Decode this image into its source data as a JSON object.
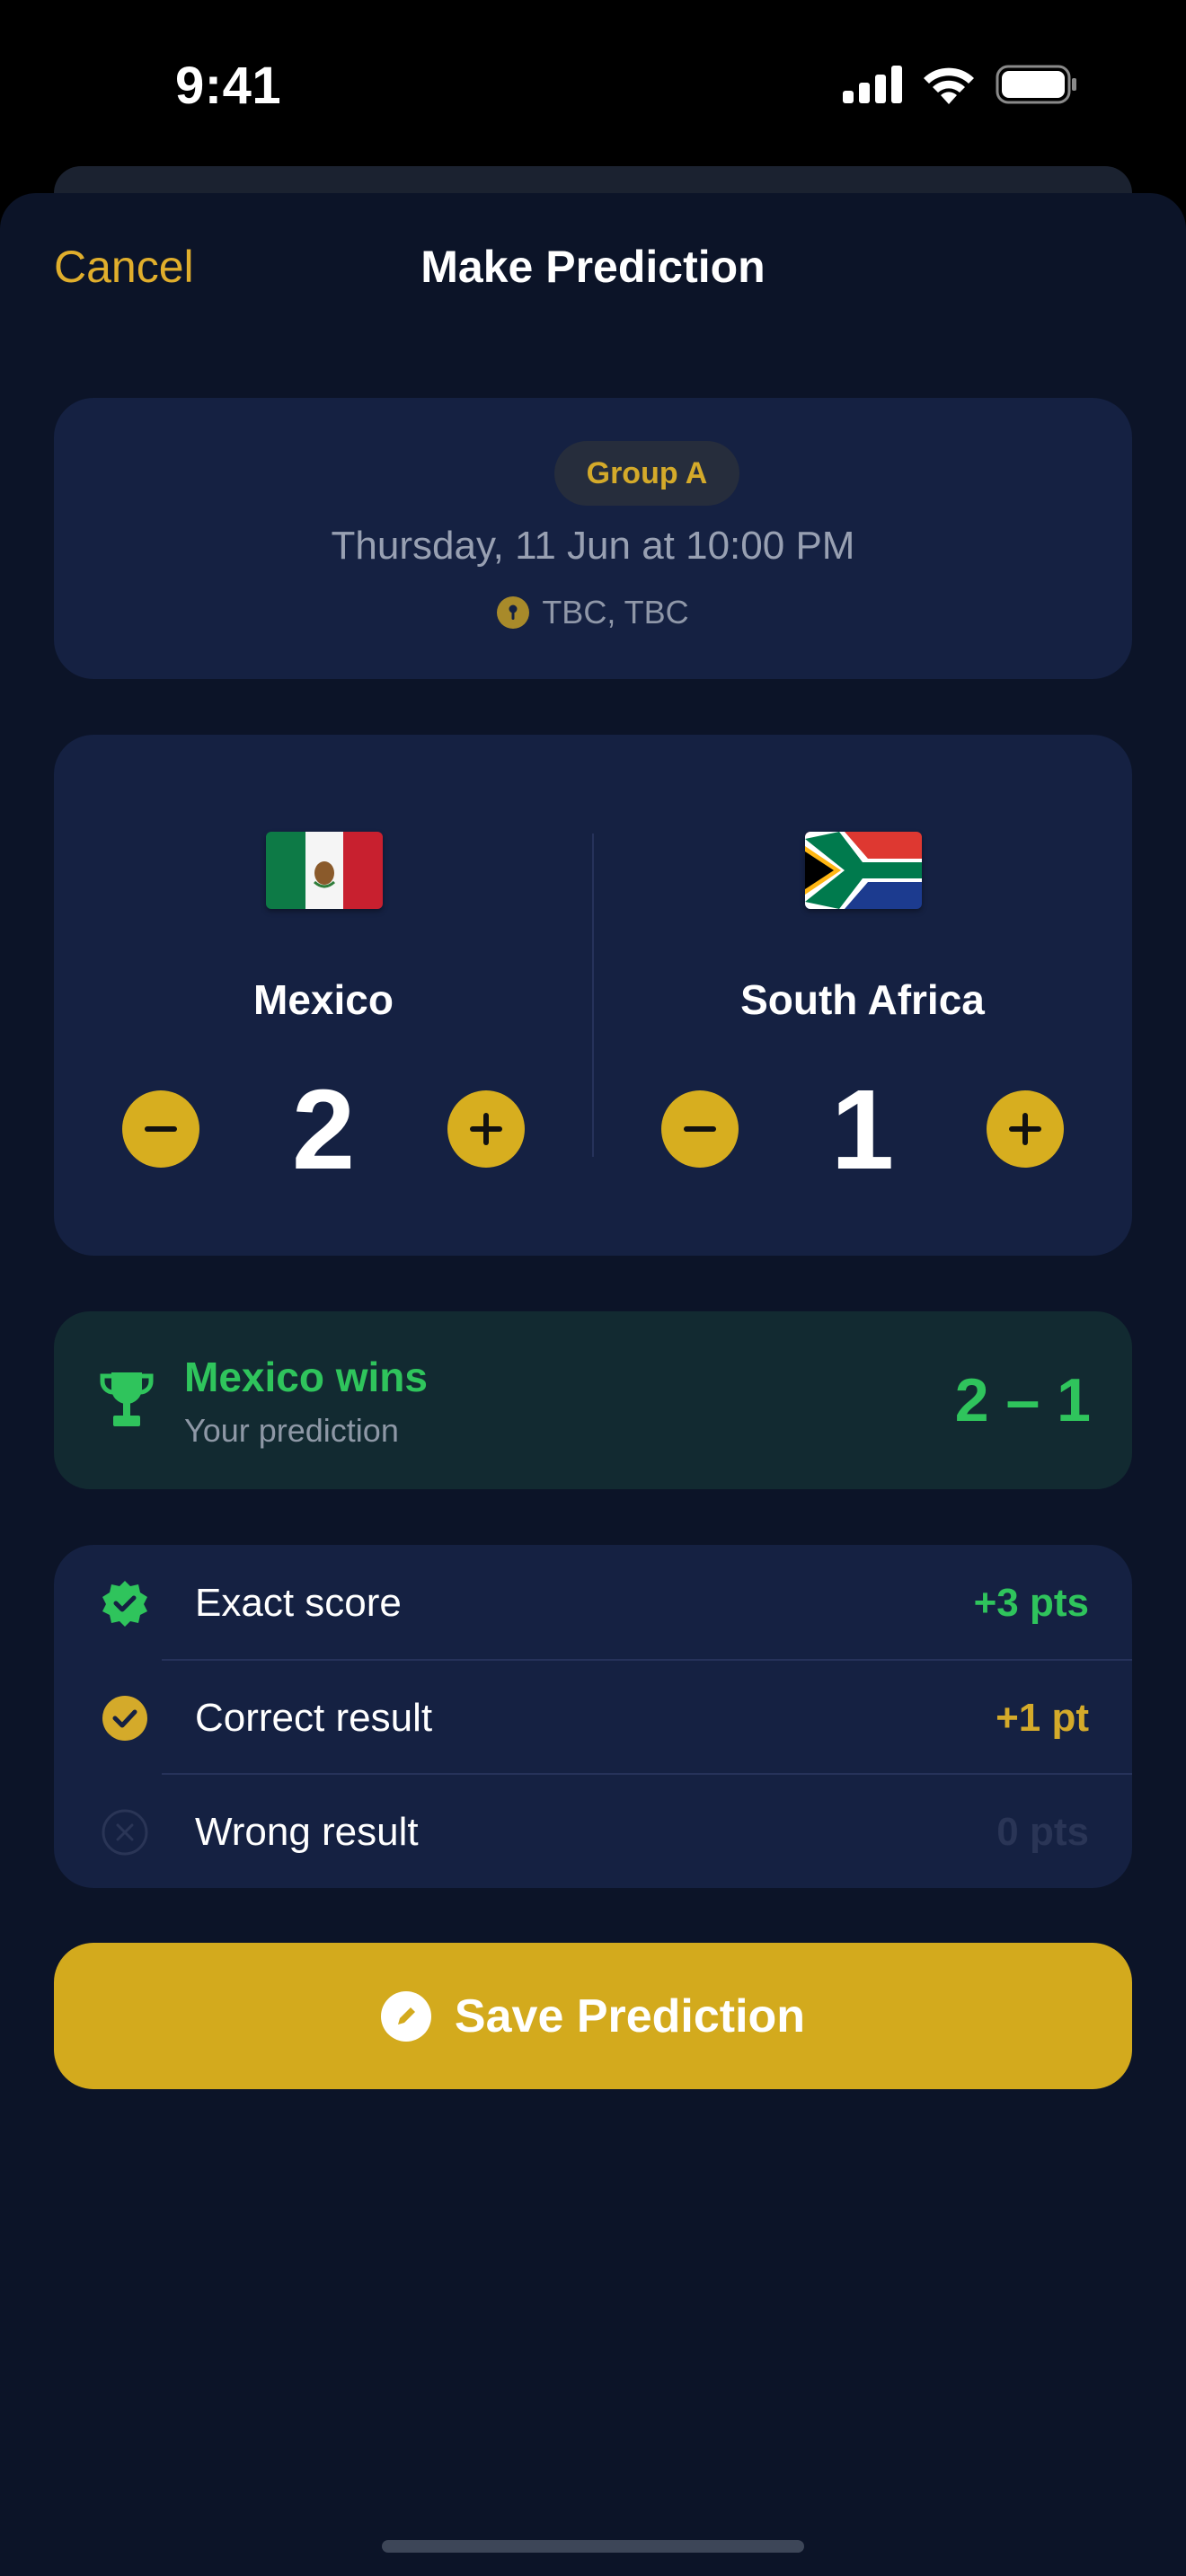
{
  "status_bar": {
    "time": "9:41"
  },
  "nav": {
    "cancel_label": "Cancel",
    "title": "Make Prediction"
  },
  "match": {
    "group": "Group A",
    "date": "Thursday, 11 Jun at 10:00 PM",
    "venue": "TBC, TBC"
  },
  "home_team": {
    "name": "Mexico",
    "flag": "mexico-flag",
    "score": "2"
  },
  "away_team": {
    "name": "South Africa",
    "flag": "south-africa-flag",
    "score": "1"
  },
  "prediction": {
    "title": "Mexico wins",
    "subtitle": "Your prediction",
    "score": "2 – 1"
  },
  "points": [
    {
      "label": "Exact score",
      "value": "+3 pts",
      "icon": "check-badge-icon",
      "color": "#2fc45c"
    },
    {
      "label": "Correct result",
      "value": "+1 pt",
      "icon": "check-circle-icon",
      "color": "#d4aa2a"
    },
    {
      "label": "Wrong result",
      "value": "0 pts",
      "icon": "x-circle-icon",
      "color": "#2a3556"
    }
  ],
  "save_button": {
    "label": "Save Prediction",
    "icon": "pencil-icon"
  },
  "colors": {
    "accent": "#d4aa2a",
    "success": "#2fc45c",
    "background": "#0c1428",
    "card": "#152142"
  }
}
